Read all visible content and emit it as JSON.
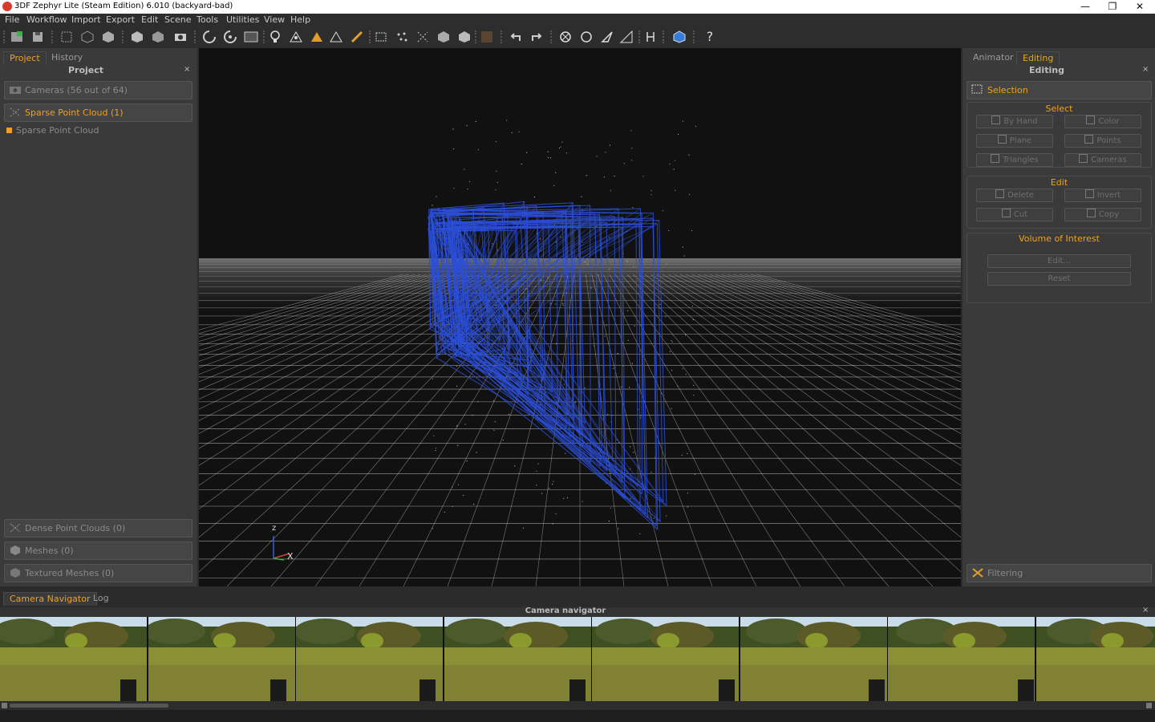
{
  "window": {
    "title": "3DF Zephyr Lite (Steam Edition) 6.010 (backyard-bad)",
    "minimize": "—",
    "restore": "❐",
    "close": "✕"
  },
  "menu": [
    "File",
    "Workflow",
    "Import",
    "Export",
    "Edit",
    "Scene",
    "Tools",
    "Utilities",
    "View",
    "Help"
  ],
  "toolbar": {
    "help_glyph": "?"
  },
  "left_panel": {
    "tabs": [
      "Project",
      "History"
    ],
    "title": "Project",
    "close": "×",
    "cameras_label": "Cameras (56 out of 64)",
    "sparse_label": "Sparse Point Cloud (1)",
    "sparse_item": "Sparse Point Cloud",
    "dense_label": "Dense Point Clouds (0)",
    "meshes_label": "Meshes (0)",
    "textured_label": "Textured Meshes (0)"
  },
  "right_panel": {
    "tabs": [
      "Animator",
      "Editing"
    ],
    "title": "Editing",
    "close": "×",
    "selection_label": "Selection",
    "select_group": "Select",
    "select_buttons": [
      "By Hand",
      "Color",
      "Plane",
      "Points",
      "Triangles",
      "Cameras"
    ],
    "edit_group": "Edit",
    "edit_buttons": [
      "Delete",
      "Invert",
      "Cut",
      "Copy"
    ],
    "voi_group": "Volume of Interest",
    "voi_buttons": [
      "Edit...",
      "Reset"
    ],
    "filtering_label": "Filtering"
  },
  "viewport": {
    "axis_z": "z",
    "axis_x": "X",
    "colors": {
      "cameras": "#2b4fd8",
      "grid": "#d0d0d0",
      "sky": "#111111"
    }
  },
  "bottom": {
    "tabs": [
      "Camera Navigator",
      "Log"
    ],
    "title": "Camera navigator",
    "close": "×",
    "thumbnail_count": 8
  },
  "colors": {
    "accent": "#f0a020",
    "panel": "#3a3a3a"
  }
}
